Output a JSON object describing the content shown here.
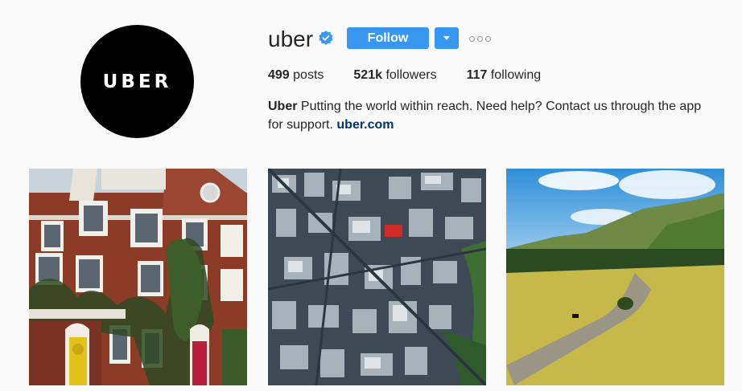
{
  "profile": {
    "avatar_text": "UBER",
    "username": "uber",
    "verified_icon": "verified-badge-icon",
    "follow_label": "Follow",
    "dropdown_icon": "caret-down-icon",
    "more_icon": "more-options-icon"
  },
  "stats": {
    "posts_count": "499",
    "posts_label": "posts",
    "followers_count": "521k",
    "followers_label": "followers",
    "following_count": "117",
    "following_label": "following"
  },
  "bio": {
    "name": "Uber",
    "text": "Putting the world within reach. Need help? Contact us through the app for support.",
    "link": "uber.com"
  },
  "posts": [
    {
      "name": "post-brick-townhouse"
    },
    {
      "name": "post-aerial-city"
    },
    {
      "name": "post-valley-road"
    }
  ],
  "colors": {
    "accent": "#3897f0",
    "background": "#fafafa",
    "link": "#003569"
  }
}
